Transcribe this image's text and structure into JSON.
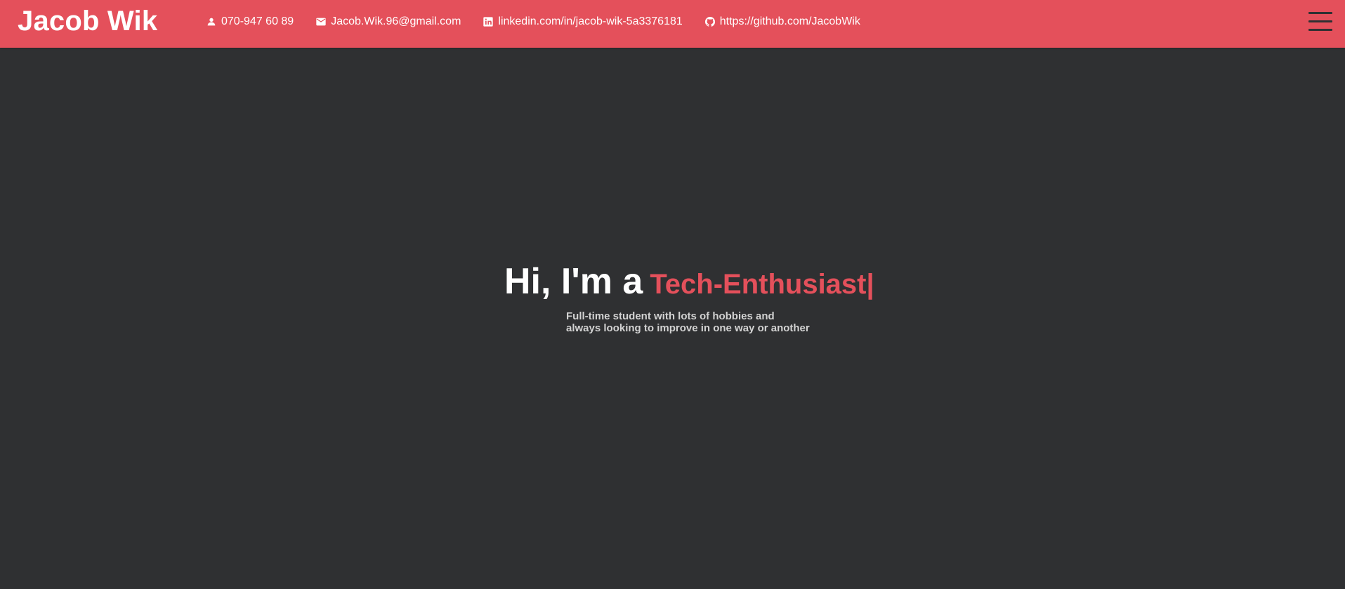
{
  "header": {
    "brand": "Jacob Wik",
    "contacts": [
      {
        "icon": "person-icon",
        "text": "070-947 60 89"
      },
      {
        "icon": "mail-icon",
        "text": "Jacob.Wik.96@gmail.com"
      },
      {
        "icon": "linkedin-icon",
        "text": "linkedin.com/in/jacob-wik-5a3376181"
      },
      {
        "icon": "github-icon",
        "text": "https://github.com/JacobWik"
      }
    ],
    "menu_icon": "hamburger-menu-icon"
  },
  "hero": {
    "intro": "Hi, I'm a",
    "role": "Tech-Enthusiast",
    "cursor": "|",
    "tagline_line1": "Full-time student with lots of hobbies and",
    "tagline_line2": "always looking to improve in one way or another"
  },
  "colors": {
    "accent": "#e4505b",
    "background": "#2f3032",
    "text": "#ffffff",
    "muted_text": "#d2d2d2"
  }
}
